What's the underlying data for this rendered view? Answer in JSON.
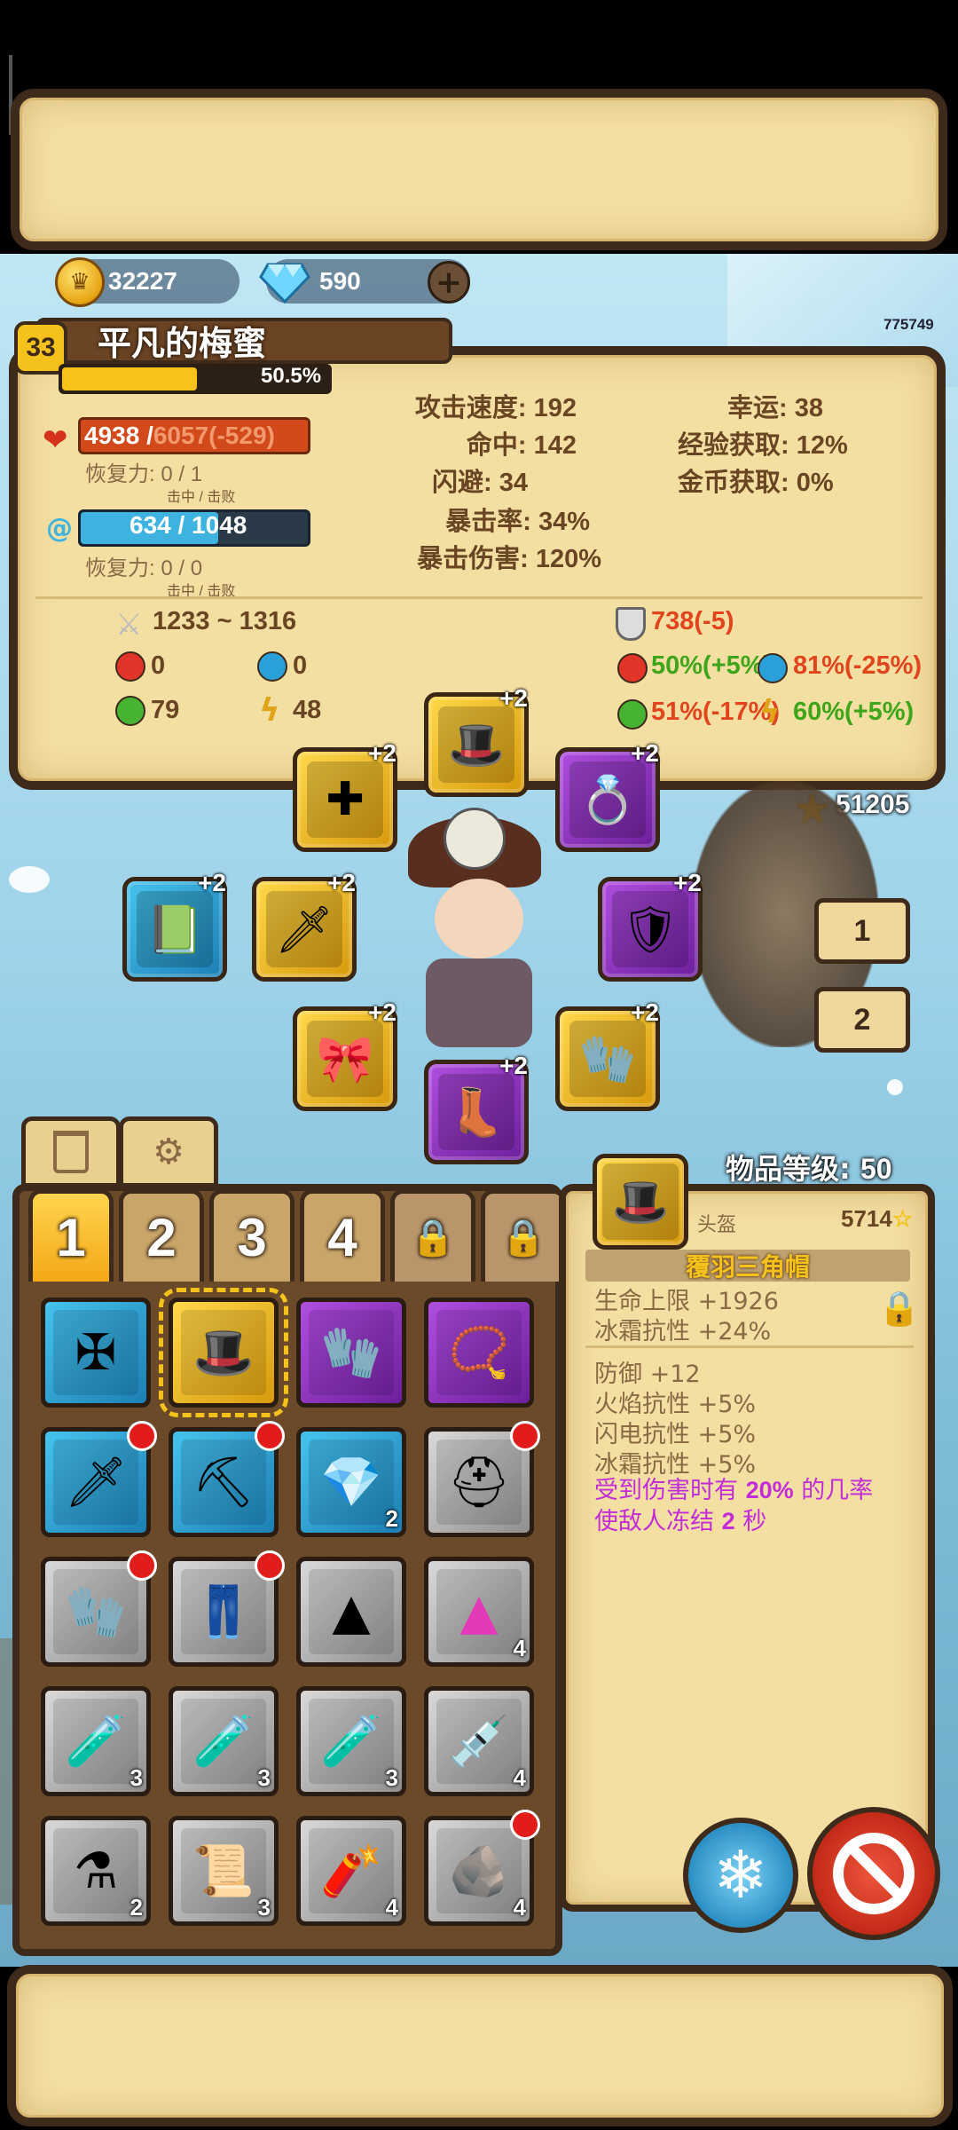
{
  "top_banner": {},
  "currency": {
    "gold": "32227",
    "diamonds": "590",
    "add": "+"
  },
  "corner_id": "775749",
  "player": {
    "level": "33",
    "name": "平凡的梅蜜",
    "exp_percent": "50.5%",
    "exp_fraction": 0.505,
    "hp_current": "4938 / ",
    "hp_max": "6057(-529)",
    "hp_regen_label": "恢复力: ",
    "hp_regen_value": "0 / 1",
    "hp_regen_sub": "击中 / 击败",
    "mp_text": "634 / 1048",
    "mp_fraction": 0.605,
    "mp_regen_label": "恢复力: ",
    "mp_regen_value": "0 / 0",
    "mp_regen_sub": "击中 / 击败"
  },
  "stats_mid": [
    {
      "label": "攻击速度: ",
      "value": "192"
    },
    {
      "label": "命中: ",
      "value": "142"
    },
    {
      "label": "闪避: ",
      "value": "34"
    },
    {
      "label": "暴击率: ",
      "value": "34%"
    },
    {
      "label": "暴击伤害: ",
      "value": "120%"
    }
  ],
  "stats_right": [
    {
      "label": "幸运: ",
      "value": "38"
    },
    {
      "label": "经验获取: ",
      "value": "12%"
    },
    {
      "label": "金币获取: ",
      "value": "0%"
    }
  ],
  "combat": {
    "attack": "1233 ~ 1316",
    "armor": "738(-5)",
    "fire_dmg": "0",
    "ice_dmg": "0",
    "poison_dmg": "79",
    "lightning_dmg": "48",
    "fire_res": "50%(+5%)",
    "ice_res": "81%(-25%)",
    "poison_res": "51%(-17%)",
    "lightning_res": "60%(+5%)"
  },
  "power_score": "51205",
  "equipment": {
    "plus": "+2"
  },
  "side_buttons": [
    "1",
    "2"
  ],
  "inventory": {
    "item_level_label": "物品等级: ",
    "item_level_value": "50",
    "tabs": [
      "1",
      "2",
      "3",
      "4"
    ],
    "counts": {
      "gem": "2",
      "pink_powder": "4",
      "red_potion": "3",
      "blue_potion": "3",
      "green_potion": "3",
      "syringe": "4",
      "teal_flask": "2",
      "scroll": "3",
      "dynamite": "4",
      "ore": "4"
    }
  },
  "item_detail": {
    "type": "头盔",
    "score": "5714",
    "name": "覆羽三角帽",
    "base_stats": [
      "生命上限 +1926",
      "冰霜抗性 +24%"
    ],
    "affixes": [
      "防御 +12",
      "火焰抗性 +5%",
      "闪电抗性 +5%",
      "冰霜抗性 +5%"
    ],
    "special_pre": "受到伤害时有 ",
    "special_chance": "20%",
    "special_mid": " 的几率使敌人冻结 ",
    "special_dur": "2",
    "special_post": " 秒"
  },
  "colors": {
    "hp": "#e0451e",
    "mp": "#3fb3e0",
    "exp": "#f7c21a",
    "green_stat": "#3fa51b",
    "red_stat": "#e0451e",
    "special": "#c22cd9"
  }
}
